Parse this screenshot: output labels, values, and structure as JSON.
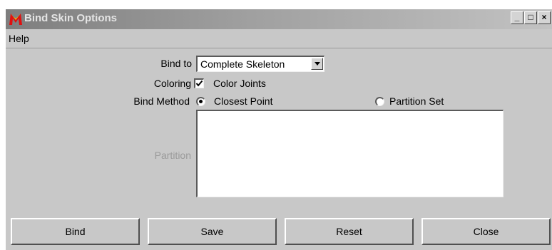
{
  "window": {
    "title": "Bind Skin Options",
    "minimize_label": "_",
    "maximize_label": "□",
    "close_label": "×"
  },
  "menu": {
    "items": [
      {
        "label": "Help"
      }
    ]
  },
  "form": {
    "bind_to_label": "Bind to",
    "bind_to_value": "Complete Skeleton",
    "coloring_label": "Coloring",
    "color_joints_label": "Color Joints",
    "color_joints_checked": true,
    "bind_method_label": "Bind Method",
    "bind_method_options": [
      {
        "label": "Closest Point",
        "selected": true
      },
      {
        "label": "Partition Set",
        "selected": false
      }
    ],
    "partition_label": "Partition",
    "partition_value": ""
  },
  "buttons": {
    "bind": "Bind",
    "save": "Save",
    "reset": "Reset",
    "close": "Close"
  },
  "colors": {
    "background": "#c8c8c8",
    "titlebar_start": "#7e7e7e",
    "titlebar_end": "#c2c2c2",
    "disabled_text": "#9a9a9a",
    "icon_red": "#e01010"
  }
}
